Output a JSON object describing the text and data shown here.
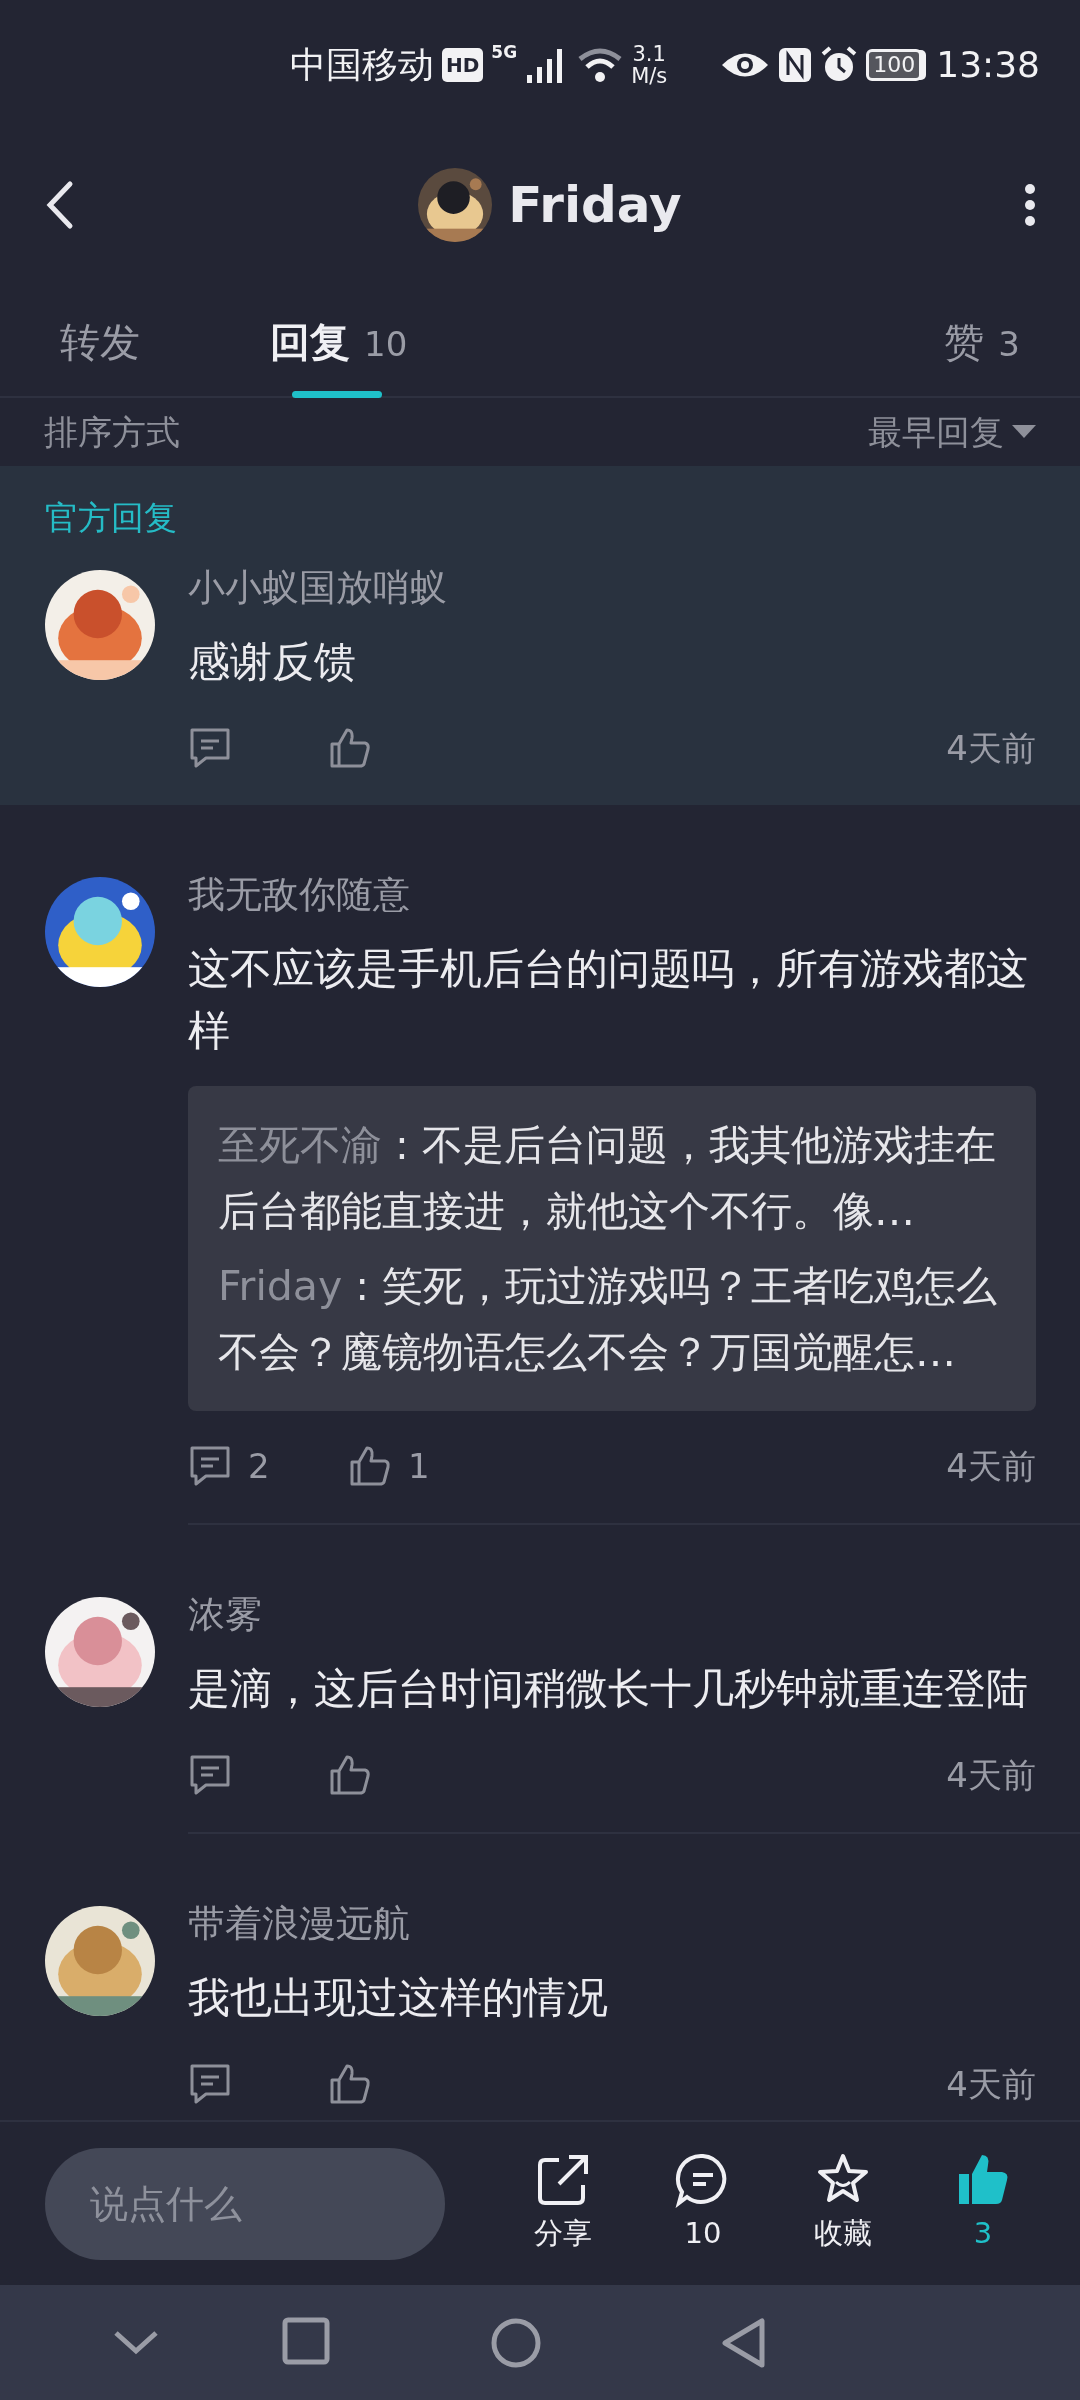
{
  "status_bar": {
    "carrier": "中国移动",
    "hd": "HD",
    "network": "5G",
    "speed_value": "3.1",
    "speed_unit": "M/s",
    "battery": "100",
    "time": "13:38"
  },
  "header": {
    "title": "Friday"
  },
  "tabs": [
    {
      "label": "转发",
      "selected": false
    },
    {
      "label": "回复",
      "count": "10",
      "selected": true
    },
    {
      "label": "赞",
      "count": "3",
      "selected": false
    }
  ],
  "sort": {
    "label": "排序方式",
    "value": "最早回复"
  },
  "comments": [
    {
      "kind": "official",
      "section_label": "官方回复",
      "author": "小小蚁国放哨蚁",
      "text": "感谢反馈",
      "time": "4天前"
    },
    {
      "kind": "normal",
      "author": "我无敌你随意",
      "text": "这不应该是手机后台的问题吗，所有游戏都这样",
      "replies": [
        {
          "author": "至死不渝",
          "text": ": 不是后台问题，我其他游戏挂在后台都能直接进，就他这个不行。像…"
        },
        {
          "author": "Friday",
          "text": ": 笑死，玩过游戏吗？王者吃鸡怎么不会？魔镜物语怎么不会？万国觉醒怎…"
        }
      ],
      "reply_count": "2",
      "like_count": "1",
      "time": "4天前"
    },
    {
      "kind": "normal",
      "author": "浓雾",
      "text": "是滴，这后台时间稍微长十几秒钟就重连登陆",
      "time": "4天前"
    },
    {
      "kind": "normal",
      "author": "带着浪漫远航",
      "text": "我也出现过这样的情况",
      "time": "4天前"
    }
  ],
  "bottom_bar": {
    "placeholder": "说点什么",
    "share_label": "分享",
    "comment_count": "10",
    "favorite_label": "收藏",
    "like_count": "3",
    "liked": true
  }
}
